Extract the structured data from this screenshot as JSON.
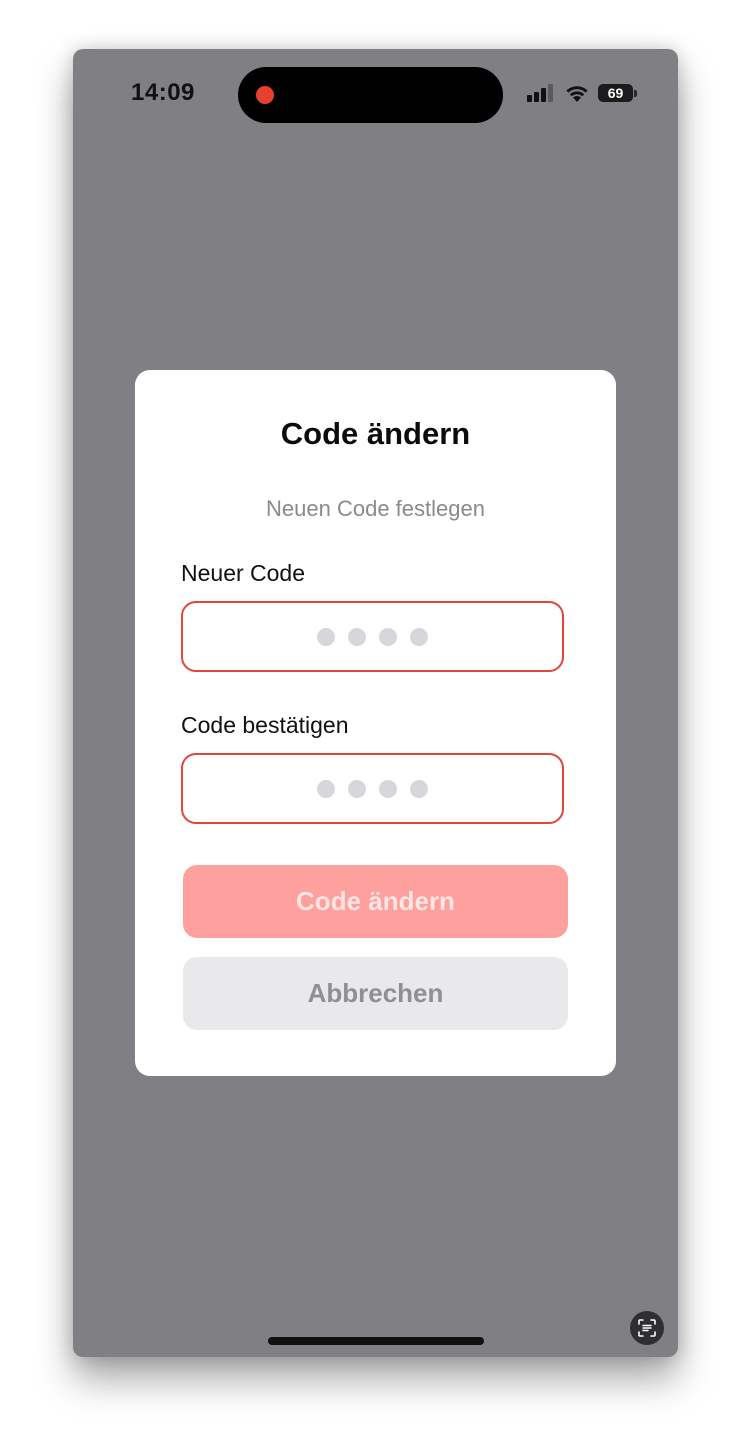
{
  "status_bar": {
    "time": "14:09",
    "battery_level": "69",
    "icons": [
      "recording-indicator-icon",
      "signal-icon",
      "wifi-icon",
      "battery-icon"
    ]
  },
  "dialog": {
    "title": "Code ändern",
    "subtitle": "Neuen Code festlegen",
    "fields": [
      {
        "label": "Neuer Code",
        "pin_length": 4
      },
      {
        "label": "Code bestätigen",
        "pin_length": 4
      }
    ],
    "primary_button": "Code ändern",
    "cancel_button": "Abbrechen"
  },
  "floating_button": {
    "icon": "scan-text-icon"
  },
  "colors": {
    "backdrop": "#807f83",
    "error_border": "#e2453a",
    "primary_disabled_bg": "#fea09d",
    "recording_dot": "#e8402f",
    "cancel_bg": "#e9e9eb"
  }
}
